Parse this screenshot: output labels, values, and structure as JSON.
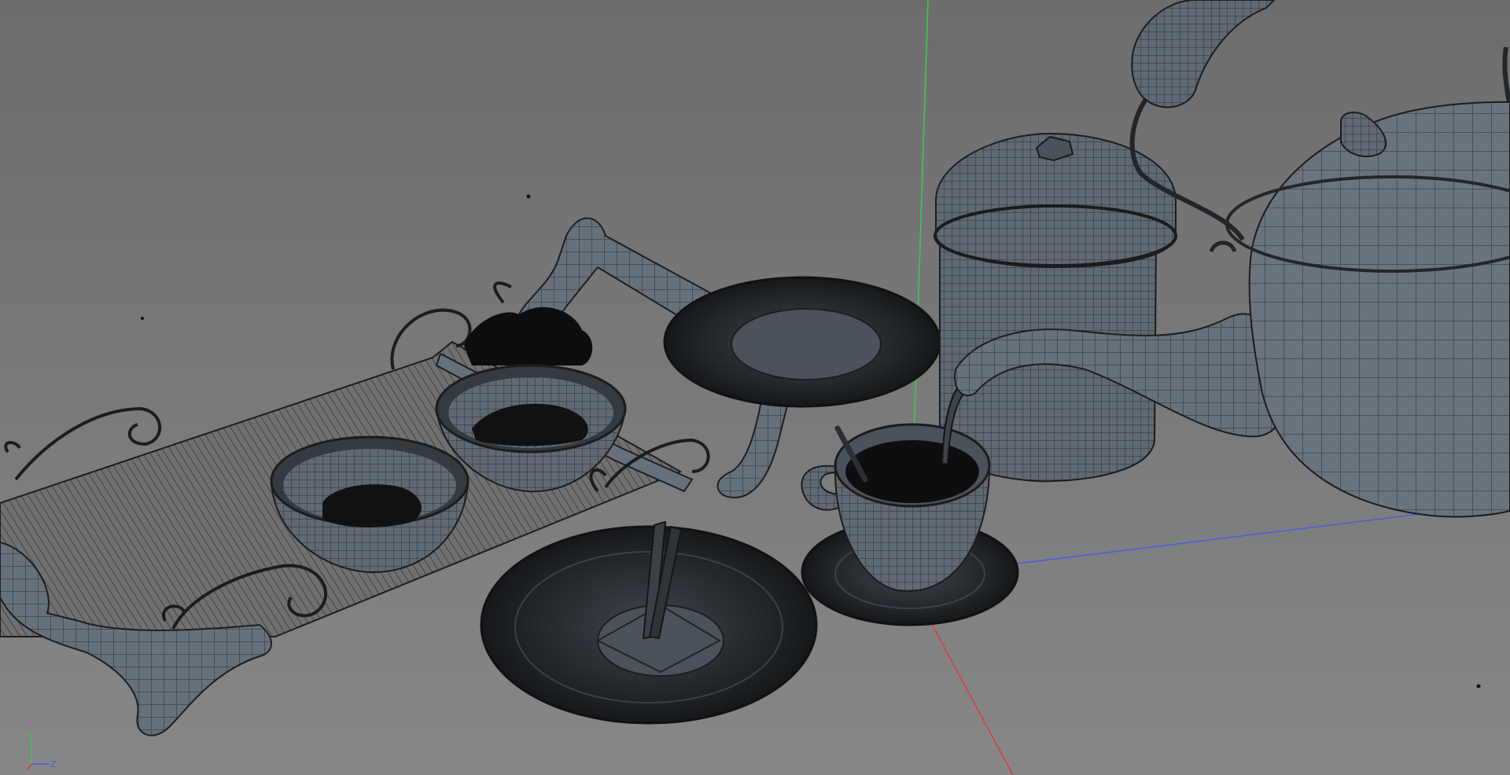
{
  "viewport": {
    "background_top": "#6d6d6d",
    "background_bottom": "#878787",
    "mesh_fill": "#5c6670",
    "mesh_dark": "#1c1e21",
    "wire_color": "#2a2d31",
    "axis_colors": {
      "x": "#e03a3a",
      "y": "#39c84a",
      "z": "#4a5ae8"
    }
  },
  "gizmo": {
    "y_label": "Y",
    "z_label": "Z"
  },
  "scene_objects": [
    "tray",
    "bowl",
    "bowl",
    "saucer",
    "saucer",
    "tea-caddy",
    "teacup",
    "teapot",
    "chopsticks"
  ]
}
